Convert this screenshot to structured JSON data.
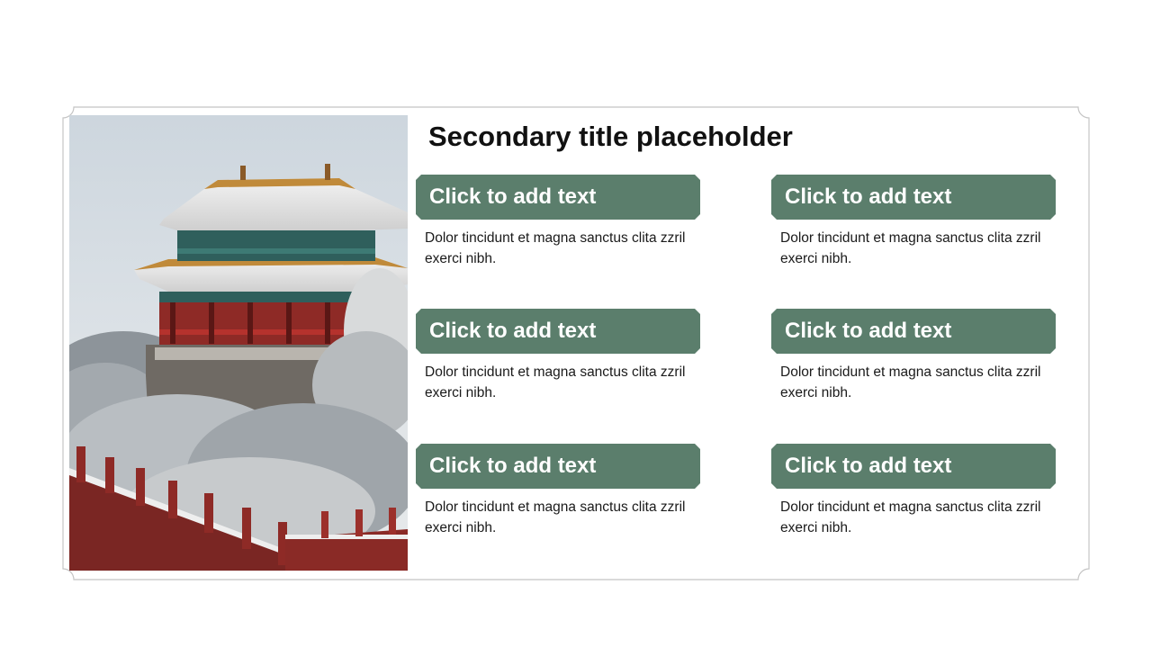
{
  "slide": {
    "title": "Secondary title placeholder",
    "accent_color": "#5b7e6c",
    "cards": [
      {
        "heading": "Click to add text",
        "body": "Dolor tincidunt et magna sanctus clita zzril exerci nibh."
      },
      {
        "heading": "Click to add text",
        "body": "Dolor tincidunt et magna sanctus clita zzril exerci nibh."
      },
      {
        "heading": "Click to add text",
        "body": "Dolor tincidunt et magna sanctus clita zzril exerci nibh."
      },
      {
        "heading": "Click to add text",
        "body": "Dolor tincidunt et magna sanctus clita zzril exerci nibh."
      },
      {
        "heading": "Click to add text",
        "body": "Dolor tincidunt et magna sanctus clita zzril exerci nibh."
      },
      {
        "heading": "Click to add text",
        "body": "Dolor tincidunt et magna sanctus clita zzril exerci nibh."
      }
    ]
  }
}
